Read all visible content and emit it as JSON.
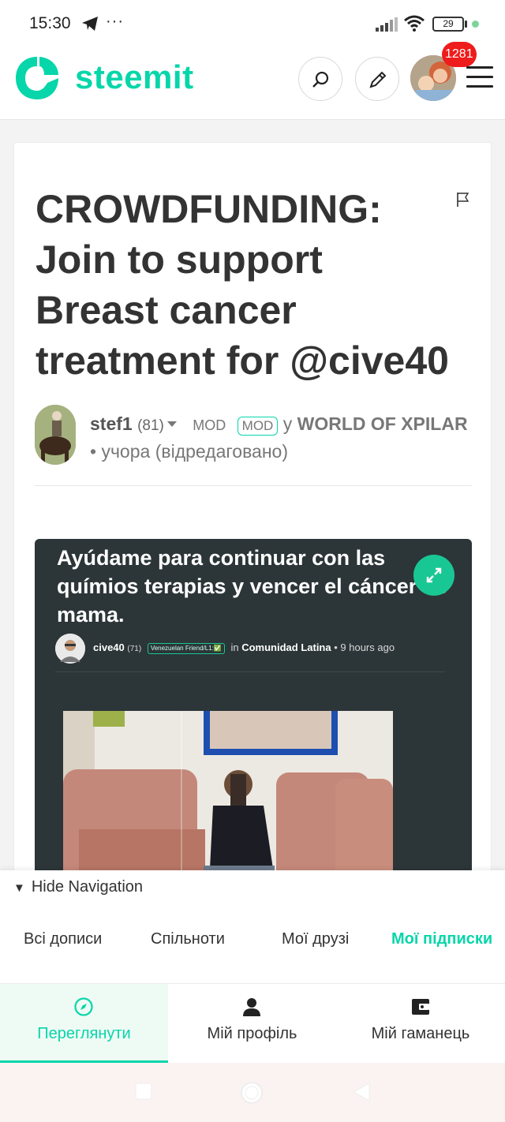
{
  "status_bar": {
    "time": "15:30",
    "dots": "···",
    "battery": "29"
  },
  "header": {
    "logo_text": "steemit",
    "notifications": "1281"
  },
  "post": {
    "title": "CROWDFUNDING: Join to support Breast cancer treatment for @cive40",
    "author": {
      "name": "stef1",
      "reputation": "(81)",
      "mod_label": "MOD",
      "mod_badge": "MOD",
      "in_word": "у",
      "community": "WORLD OF XPILAR",
      "separator": "•",
      "time": "учора (відредаговано)"
    },
    "embed": {
      "title": "Ayúdame para continuar con las químios terapias y vencer el cáncer de mama.",
      "author": "cive40",
      "reputation": "(71)",
      "tag": "Venezuelan Friend/L1:✅",
      "in_word": "in",
      "community": "Comunidad Latina",
      "time": "• 9 hours ago"
    }
  },
  "navigation": {
    "hide_label": "Hide Navigation",
    "links": [
      {
        "label": "Всі дописи"
      },
      {
        "label": "Спільноти"
      },
      {
        "label": "Мої друзі"
      },
      {
        "label": "Мої підписки",
        "active": true
      }
    ],
    "tabs": [
      {
        "label": "Переглянути",
        "icon": "compass-icon",
        "active": true
      },
      {
        "label": "Мій профіль",
        "icon": "profile-icon"
      },
      {
        "label": "Мій гаманець",
        "icon": "wallet-icon"
      }
    ]
  },
  "colors": {
    "accent": "#07d6aa",
    "badge": "#ee1c1c",
    "embed_bg": "#2c3538"
  }
}
